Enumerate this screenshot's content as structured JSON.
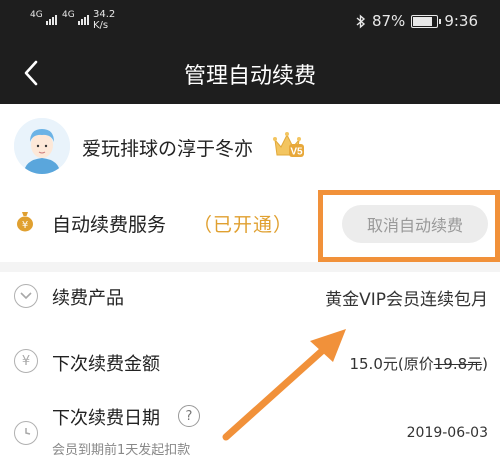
{
  "status_bar": {
    "signal1": "4G",
    "signal2": "4G",
    "net_speed_value": "34.2",
    "net_speed_unit": "K/s",
    "bluetooth_icon": "bluetooth-icon",
    "battery_text": "87%",
    "battery_level": 0.87,
    "time": "9:36"
  },
  "nav": {
    "back_icon": "chevron-left-icon",
    "title": "管理自动续费"
  },
  "user": {
    "name": "爱玩排球の淳于冬亦",
    "vip_badge": "V5"
  },
  "service": {
    "label": "自动续费服务",
    "status": "（已开通）",
    "cancel_label": "取消自动续费"
  },
  "rows": {
    "product_label": "续费产品",
    "product_value": "黄金VIP会员连续包月",
    "amount_label": "下次续费金额",
    "amount_price": "15.0元",
    "amount_original_prefix": "(原价",
    "amount_original_price": "19.8元",
    "amount_original_suffix": ")",
    "date_label": "下次续费日期",
    "date_help": "?",
    "date_value": "2019-06-03",
    "date_note": "会员到期前1天发起扣款"
  },
  "colors": {
    "accent_gold": "#e0a030",
    "highlight_orange": "#f1913a",
    "bar_dark": "#1e1e1e"
  }
}
